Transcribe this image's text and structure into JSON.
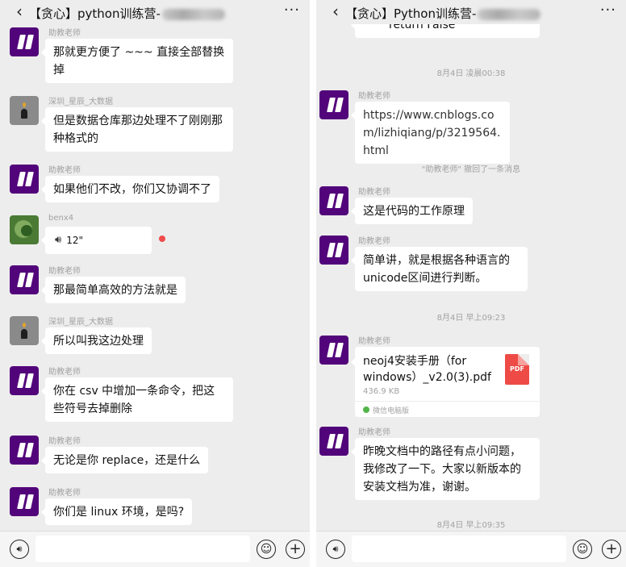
{
  "left": {
    "header": {
      "back_icon": "chevron-left-icon",
      "title": "【贪心】python训练营-",
      "more": "···"
    },
    "messages": [
      {
        "sender": "助教老师",
        "text": "那就更方便了 ~~~ 直接全部替换掉"
      },
      {
        "sender": "深圳_星辰_大数据",
        "text": "但是数据仓库那边处理不了刚刚那种格式的"
      },
      {
        "sender": "助教老师",
        "text": "如果他们不改，你们又协调不了"
      },
      {
        "sender": "benx4",
        "voice_icon": "speaker-icon",
        "duration": "12\""
      },
      {
        "sender": "助教老师",
        "text": "那最简单高效的方法就是"
      },
      {
        "sender": "深圳_星辰_大数据",
        "text": "所以叫我这边处理"
      },
      {
        "sender": "助教老师",
        "text": "你在 csv 中增加一条命令，把这些符号去掉删除"
      },
      {
        "sender": "助教老师",
        "text": "无论是你 replace，还是什么"
      },
      {
        "sender": "助教老师",
        "text": "你们是 linux 环境，是吗?"
      }
    ]
  },
  "right": {
    "header": {
      "back_icon": "chevron-left-icon",
      "title": "【贪心】Python训练营-",
      "more": "···"
    },
    "code_tail": "return False",
    "time1": "8月4日 凌晨00:38",
    "link_msg": {
      "sender": "助教老师",
      "text": "https://www.cnblogs.com/lizhiqiang/p/3219564.html"
    },
    "recall_notice": "\"助教老师\" 撤回了一条消息",
    "msg2": {
      "sender": "助教老师",
      "text": "这是代码的工作原理"
    },
    "msg3": {
      "sender": "助教老师",
      "text": "简单讲，就是根据各种语言的unicode区间进行判断。"
    },
    "time2": "8月4日 早上09:23",
    "file_msg": {
      "sender": "助教老师",
      "name": "neoj4安装手册（for windows）_v2.0(3).pdf",
      "size": "436.9 KB",
      "type": "PDF",
      "source": "微信电脑版"
    },
    "msg4": {
      "sender": "助教老师",
      "text": "昨晚文档中的路径有点小问题，我修改了一下。大家以新版本的安装文档为准，谢谢。"
    },
    "time3": "8月4日 早上09:35"
  },
  "input_bar": {
    "voice_icon": "voice-input-icon",
    "emoji_icon": "emoji-icon",
    "plus_icon": "plus-icon"
  },
  "colors": {
    "background": "#ededed",
    "bubble": "#ffffff",
    "teacher_avatar": "#52047a",
    "unread_dot": "#f04b4b",
    "pdf_icon": "#ee4b46"
  }
}
